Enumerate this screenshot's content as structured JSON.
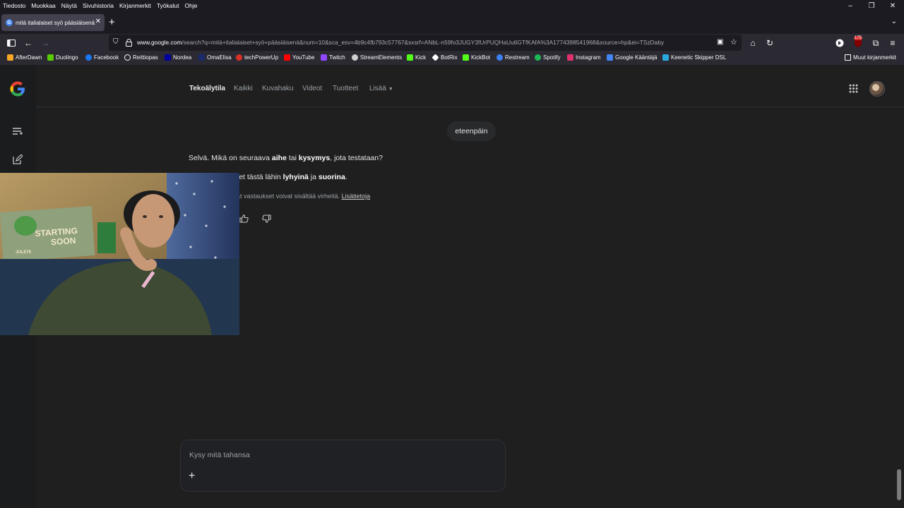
{
  "menubar": {
    "items": [
      "Tiedosto",
      "Muokkaa",
      "Näytä",
      "Sivuhistoria",
      "Kirjanmerkit",
      "Työkalut",
      "Ohje"
    ]
  },
  "window_controls": {
    "minimize": "–",
    "restore": "❐",
    "close": "✕"
  },
  "tab": {
    "title": "mitä italialaiset syö pääsiäisenä",
    "close": "✕",
    "new": "+"
  },
  "navbar": {
    "url_host": "www.google.com",
    "url_rest": "/search?q=mitä+italialaiset+syö+pääsiäisenä&num=10&sca_esv=4b9c4fb793c57767&sxsrf=ANbL-n59fo3JUGY3fUrPUQHaUu6GTfKAfA%3A1774398541968&source=hp&ei=TSzDaby",
    "ext_badge": "175"
  },
  "bookmarks": [
    {
      "label": "AfterDawn",
      "color": "#f5a623"
    },
    {
      "label": "Duolingo",
      "color": "#58cc02"
    },
    {
      "label": "Facebook",
      "color": "#1877f2"
    },
    {
      "label": "Reittiopas",
      "color": "#9aa0a6"
    },
    {
      "label": "Nordea",
      "color": "#0000a0"
    },
    {
      "label": "OmaElisa",
      "color": "#1a2a6c"
    },
    {
      "label": "techPowerUp",
      "color": "#d93025"
    },
    {
      "label": "YouTube",
      "color": "#ff0000"
    },
    {
      "label": "Twitch",
      "color": "#9146ff"
    },
    {
      "label": "StreamElements",
      "color": "#d0d0d0"
    },
    {
      "label": "Kick",
      "color": "#53fc18"
    },
    {
      "label": "BotRix",
      "color": "#ffffff"
    },
    {
      "label": "KickBot",
      "color": "#53fc18"
    },
    {
      "label": "Restream",
      "color": "#3b82f6"
    },
    {
      "label": "Spotify",
      "color": "#1db954"
    },
    {
      "label": "Instagram",
      "color": "#e1306c"
    },
    {
      "label": "Google Kääntäjä",
      "color": "#4285f4"
    },
    {
      "label": "Keenetic Skipper DSL",
      "color": "#29a8e0"
    }
  ],
  "bookmarks_other": "Muut kirjanmerkit",
  "google": {
    "logo": "G",
    "tabs": [
      "Tekoälytila",
      "Kaikki",
      "Kuvahaku",
      "Videot",
      "Tuotteet",
      "Lisää"
    ],
    "user_message": "eteenpäin",
    "answer_line1": {
      "t1": "Selvä. Mikä on seuraava ",
      "b1": "aihe",
      "t2": " tai ",
      "b2": "kysymys",
      "t3": ", jota testataan?"
    },
    "answer_line2": {
      "t1": "Pidän vastaukset tästä lähin ",
      "b1": "lyhyinä",
      "t2": " ja ",
      "b2": "suorina",
      "t3": "."
    },
    "disclaimer": "Tekoälyn tuottamat vastaukset voivat sisältää virheitä.",
    "disclaimer_link": "Lisätietoja",
    "ask_placeholder": "Kysy mitä tahansa",
    "ask_plus": "+"
  },
  "webcam": {
    "poster_text_line1": "STARTING",
    "poster_text_line2": "SOON",
    "poster_tag": "JULE75"
  },
  "colors": {
    "browser_chrome": "#1c1b22",
    "toolbar": "#2b2a33",
    "page_bg": "#1f1f1f",
    "bubble": "#282a2c"
  }
}
